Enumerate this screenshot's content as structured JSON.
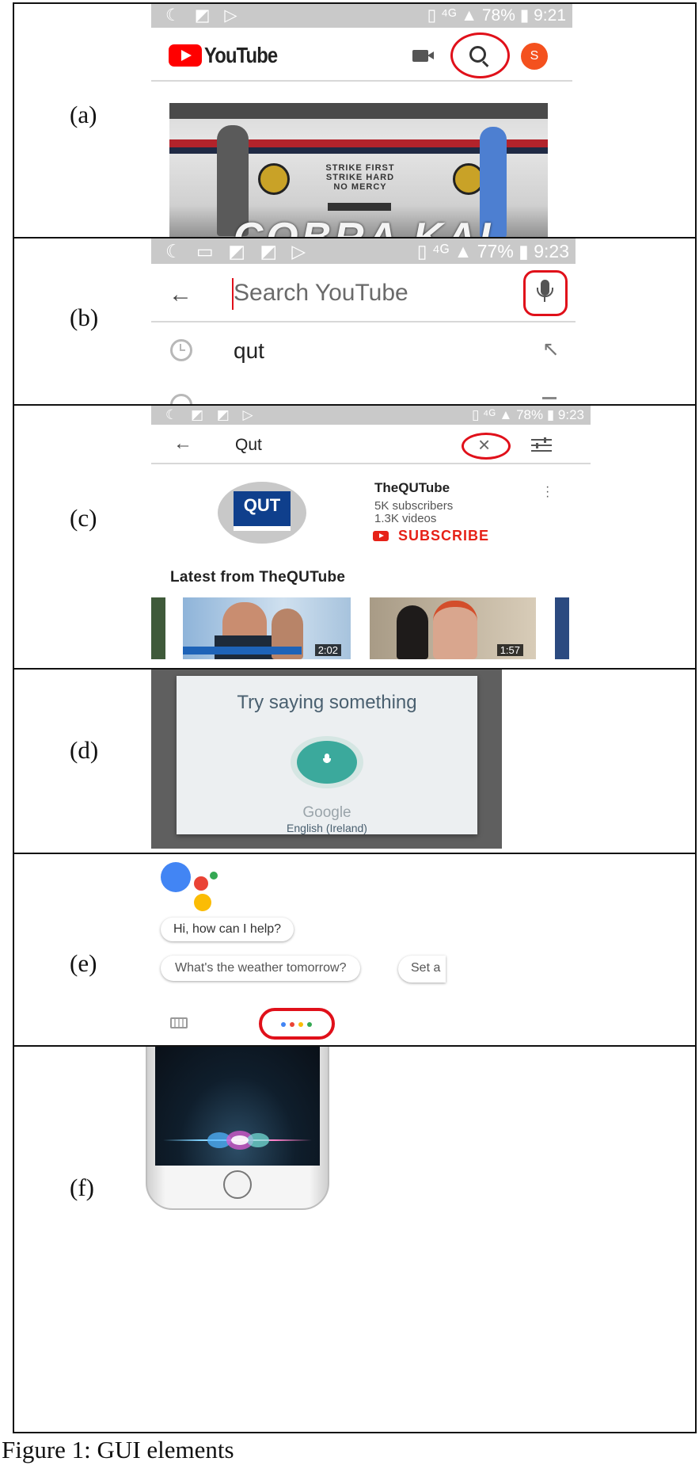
{
  "rows": [
    {
      "label": "(a)"
    },
    {
      "label": "(b)"
    },
    {
      "label": "(c)"
    },
    {
      "label": "(d)"
    },
    {
      "label": "(e)"
    },
    {
      "label": "(f)"
    }
  ],
  "caption": "Figure 1: GUI elements",
  "a": {
    "status_battery": "78%",
    "status_time": "9:21",
    "logo_text": "YouTube",
    "avatar_letter": "S",
    "video_text": [
      "STRIKE FIRST",
      "STRIKE HARD",
      "NO MERCY"
    ],
    "video_title_art": "COBRA KAI"
  },
  "b": {
    "status_battery": "77%",
    "status_time": "9:23",
    "search_placeholder": "Search YouTube",
    "history_item": "qut"
  },
  "c": {
    "status_battery": "78%",
    "status_time": "9:23",
    "query": "Qut",
    "channel_logo": "QUT",
    "channel_name": "TheQUTube",
    "subscribers": "5K subscribers",
    "videos": "1.3K videos",
    "subscribe_label": "SUBSCRIBE",
    "section_title": "Latest from TheQUTube",
    "thumb1_duration": "2:02",
    "thumb2_duration": "1:57"
  },
  "d": {
    "prompt": "Try saying something",
    "provider": "Google",
    "language": "English (Ireland)"
  },
  "e": {
    "greeting": "Hi, how can I help?",
    "suggestion1": "What's the weather tomorrow?",
    "suggestion2": "Set a"
  },
  "colors": {
    "yt_red": "#ff0000",
    "google_blue": "#4285f4",
    "google_red": "#ea4335",
    "google_yellow": "#fbbc05",
    "google_green": "#34a853",
    "mic_teal": "#3ba99c",
    "qut_blue": "#0f3f8c"
  }
}
